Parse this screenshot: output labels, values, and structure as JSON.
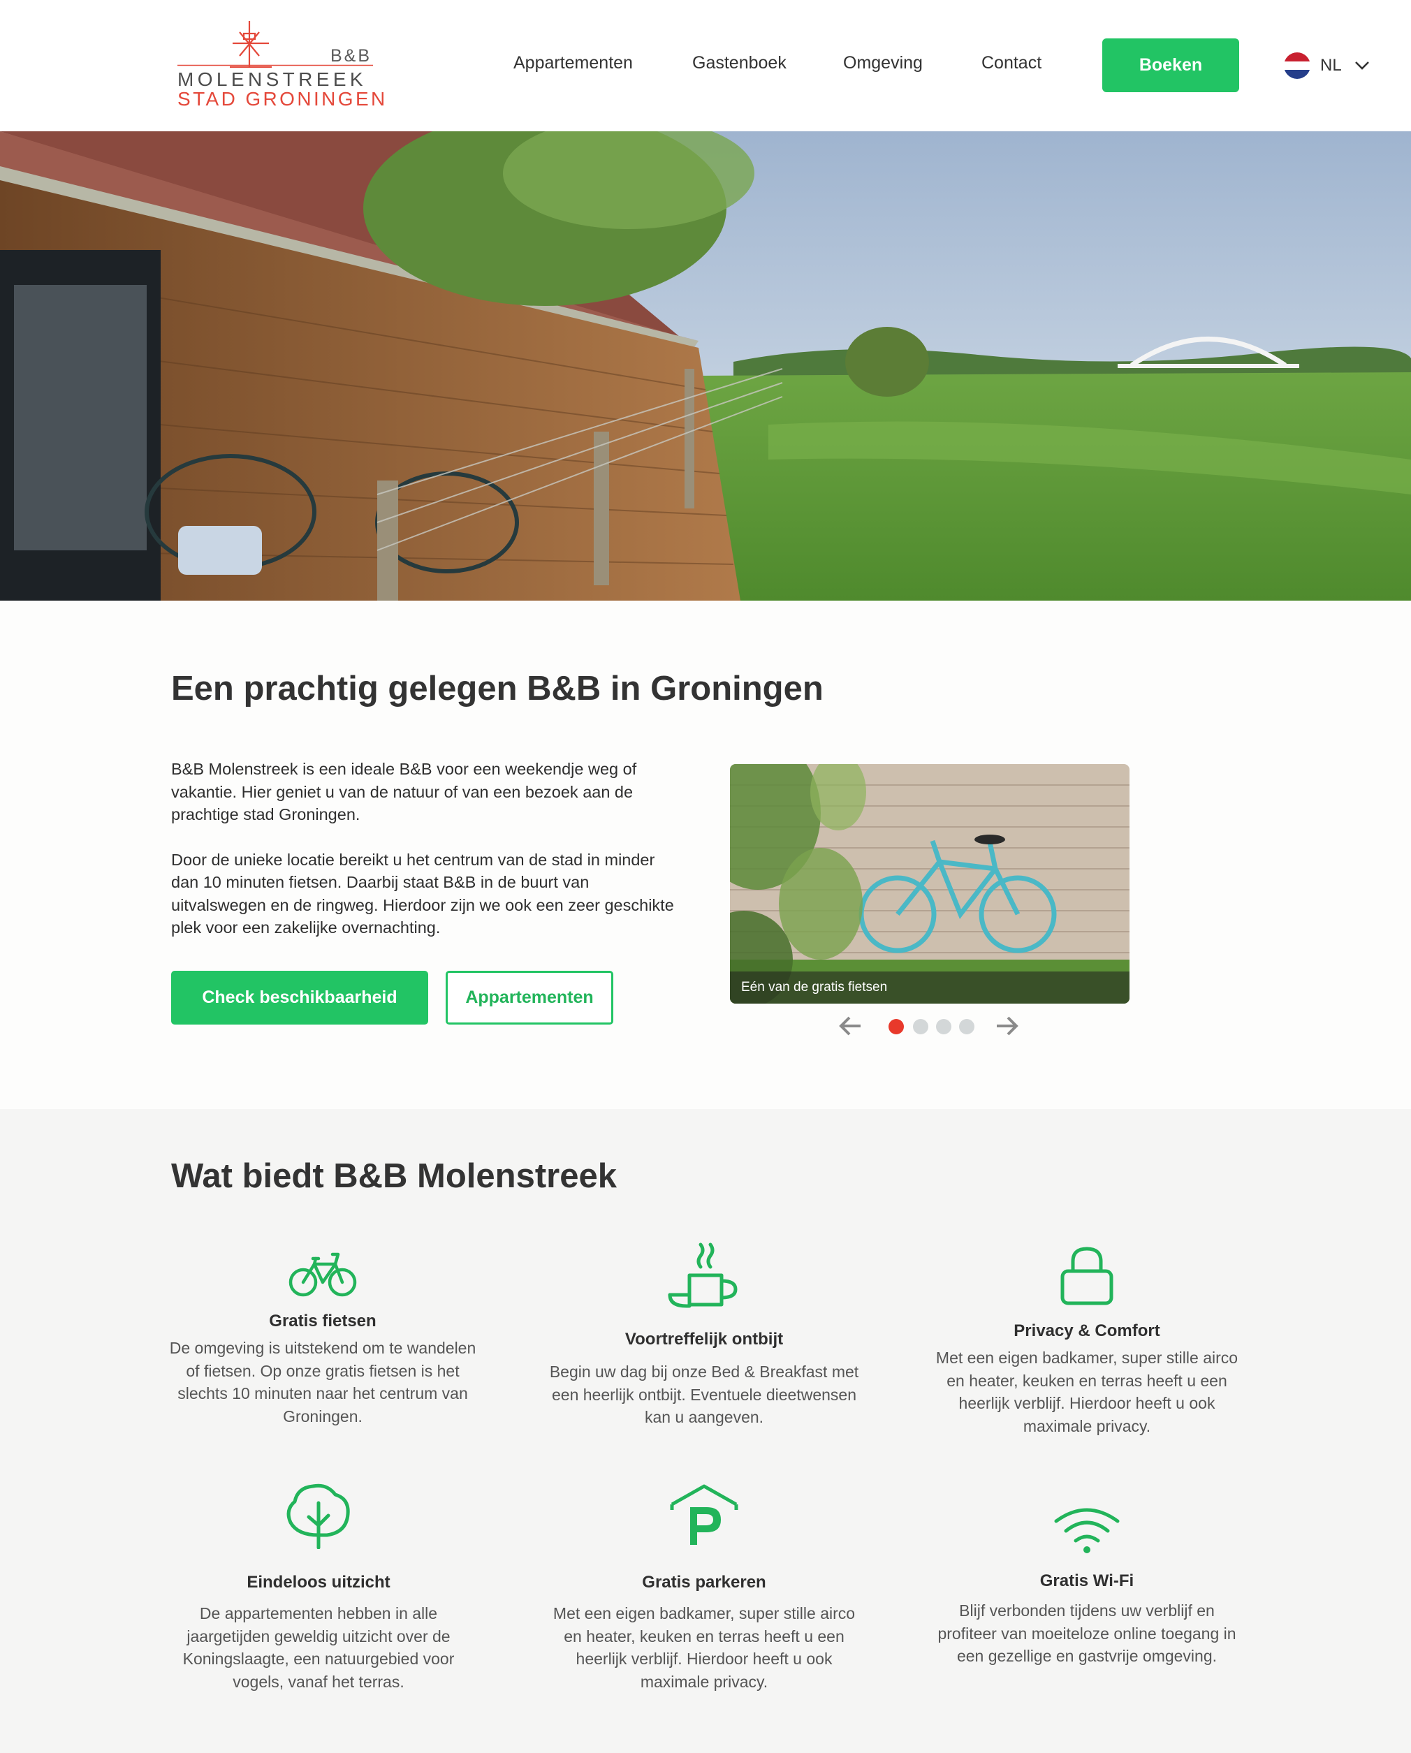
{
  "header": {
    "logo": {
      "top": "B&B",
      "line1": "MOLENSTREEK",
      "line2": "STAD GRONINGEN"
    },
    "nav": [
      "Appartementen",
      "Gastenboek",
      "Omgeving",
      "Contact"
    ],
    "book_label": "Boeken",
    "language": "NL"
  },
  "colors": {
    "accent": "#22c464",
    "logo_red": "#e4483a",
    "dot_active": "#e8392b",
    "dot_inactive": "#d3d7d8"
  },
  "intro": {
    "title": "Een prachtig gelegen B&B in Groningen",
    "paragraphs": [
      "B&B Molenstreek is een ideale B&B voor een weekendje weg of vakantie. Hier geniet u van de natuur of van een bezoek aan de prachtige stad Groningen.",
      "Door de unieke locatie bereikt u het centrum van de stad in minder dan 10 minuten fietsen. Daarbij staat B&B in de buurt van uitvalswegen en de ringweg. Hierdoor zijn we ook een zeer geschikte plek voor een zakelijke overnachting."
    ],
    "primary_button": "Check beschikbaarheid",
    "secondary_button": "Appartementen",
    "slider": {
      "caption": "Eén van de gratis fietsen",
      "total_slides": 4,
      "active_slide": 1
    }
  },
  "features": {
    "title": "Wat biedt B&B Molenstreek",
    "items": [
      {
        "icon": "bicycle-icon",
        "title": "Gratis fietsen",
        "text": "De omgeving is uitstekend om te wandelen of fietsen. Op onze gratis fietsen is het slechts 10 minuten naar het centrum van Groningen."
      },
      {
        "icon": "coffee-cup-icon",
        "title": "Voortreffelijk ontbijt",
        "text": "Begin uw dag bij onze Bed & Breakfast met een heerlijk ontbijt. Eventuele dieetwensen kan u aangeven."
      },
      {
        "icon": "lock-icon",
        "title": "Privacy & Comfort",
        "text": "Met een eigen badkamer, super stille airco en heater, keuken en terras heeft u een heerlijk verblijf. Hierdoor heeft u ook maximale privacy."
      },
      {
        "icon": "tree-icon",
        "title": "Eindeloos uitzicht",
        "text": "De appartementen hebben in alle jaargetijden geweldig uitzicht over de Koningslaagte, een natuurgebied voor vogels, vanaf het terras."
      },
      {
        "icon": "parking-icon",
        "title": "Gratis parkeren",
        "text": "Met een eigen badkamer, super stille airco en heater, keuken en terras heeft u een heerlijk verblijf. Hierdoor heeft u ook maximale privacy."
      },
      {
        "icon": "wifi-icon",
        "title": "Gratis Wi-Fi",
        "text": "Blijf verbonden tijdens uw verblijf en profiteer van moeiteloze online toegang in een gezellige en gastvrije omgeving."
      }
    ]
  }
}
